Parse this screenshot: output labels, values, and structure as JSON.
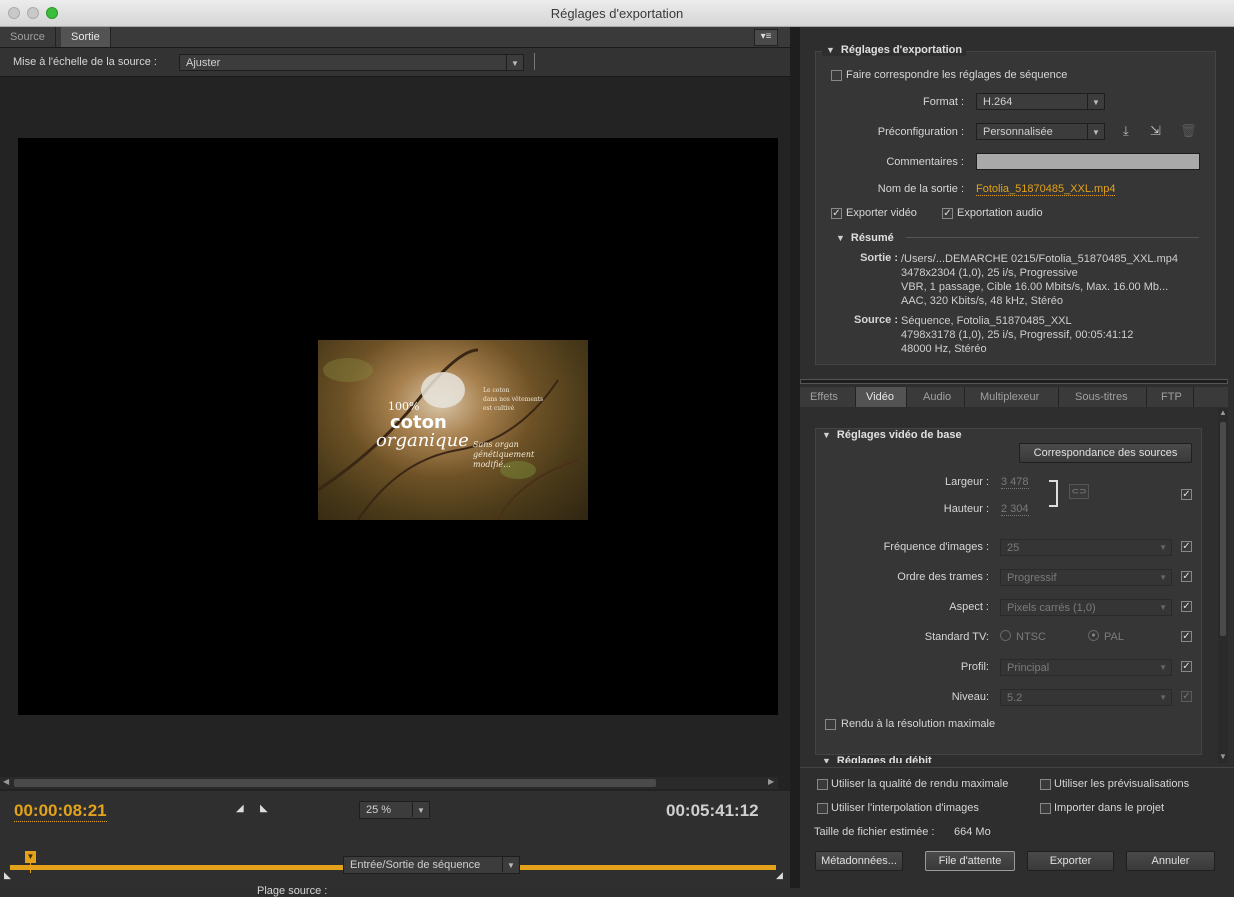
{
  "window": {
    "title": "Réglages d'exportation"
  },
  "left": {
    "tabs": [
      "Source",
      "Sortie"
    ],
    "scale_label": "Mise à l'échelle de la source :",
    "scale_value": "Ajuster",
    "preview_text": {
      "line1": "100%",
      "line2": "coton",
      "line3": "organique",
      "side1": "Le coton",
      "side2": "dans nos vêtements",
      "side3": "est cultivé",
      "side4": "Sans organ",
      "side5": "génétiquement",
      "side6": "modifié..."
    },
    "timecode_current": "00:00:08:21",
    "timecode_total": "00:05:41:12",
    "zoom": "25 %",
    "playhead_fraction": 0.026,
    "source_range_label": "Plage source :",
    "source_range_value": "Entrée/Sortie de séquence"
  },
  "export": {
    "section_title": "Réglages d'exportation",
    "match_sequence": "Faire correspondre les réglages de séquence",
    "format_label": "Format :",
    "format_value": "H.264",
    "preset_label": "Préconfiguration :",
    "preset_value": "Personnalisée",
    "comments_label": "Commentaires :",
    "output_name_label": "Nom de la sortie :",
    "output_name_value": "Fotolia_51870485_XXL.mp4",
    "export_video": "Exporter vidéo",
    "export_audio": "Exportation audio",
    "summary_title": "Résumé",
    "output_label": "Sortie :",
    "output_lines": [
      "/Users/...DEMARCHE 0215/Fotolia_51870485_XXL.mp4",
      "3478x2304 (1,0), 25 i/s, Progressive",
      "VBR, 1 passage, Cible 16.00  Mbits/s, Max. 16.00  Mb...",
      "AAC, 320  Kbits/s, 48  kHz, Stéréo"
    ],
    "source_label": "Source :",
    "source_lines": [
      "Séquence, Fotolia_51870485_XXL",
      "4798x3178 (1,0), 25  i/s, Progressif, 00:05:41:12",
      "48000 Hz, Stéréo"
    ]
  },
  "tabs2": [
    "Effets",
    "Vidéo",
    "Audio",
    "Multiplexeur",
    "Sous-titres",
    "FTP"
  ],
  "video": {
    "section_title": "Réglages vidéo de base",
    "match_source_btn": "Correspondance des sources",
    "width_label": "Largeur :",
    "width_value": "3 478",
    "height_label": "Hauteur :",
    "height_value": "2 304",
    "fps_label": "Fréquence d'images :",
    "fps_value": "25",
    "field_order_label": "Ordre des trames :",
    "field_order_value": "Progressif",
    "aspect_label": "Aspect :",
    "aspect_value": "Pixels carrés (1,0)",
    "tv_label": "Standard TV:",
    "tv_ntsc": "NTSC",
    "tv_pal": "PAL",
    "profile_label": "Profil:",
    "profile_value": "Principal",
    "level_label": "Niveau:",
    "level_value": "5.2",
    "max_render": "Rendu à la résolution maximale",
    "next_section": "Réglages du débit"
  },
  "bottom": {
    "max_quality": "Utiliser la qualité de rendu maximale",
    "use_previews": "Utiliser les prévisualisations",
    "frame_blend": "Utiliser l'interpolation d'images",
    "import_project": "Importer dans le projet",
    "filesize_label": "Taille de fichier estimée :",
    "filesize_value": "664 Mo",
    "metadata_btn": "Métadonnées...",
    "queue_btn": "File d'attente",
    "export_btn": "Exporter",
    "cancel_btn": "Annuler"
  },
  "colors": {
    "accent": "#e3a21a",
    "bg": "#2e2e2e"
  }
}
